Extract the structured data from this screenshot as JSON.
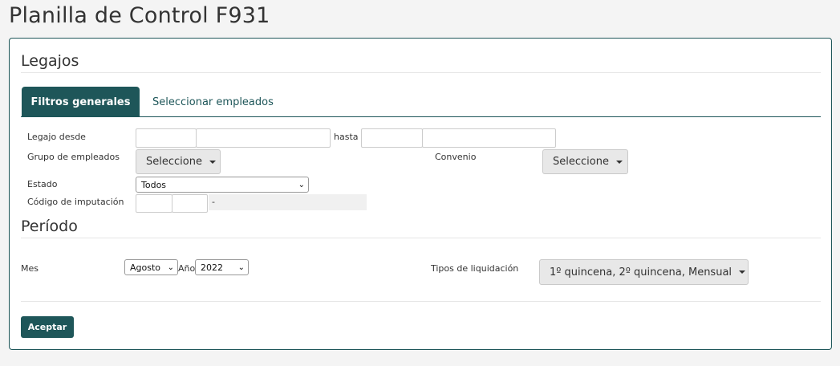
{
  "page": {
    "title": "Planilla de Control F931"
  },
  "legajos": {
    "title": "Legajos",
    "tabs": [
      {
        "label": "Filtros generales",
        "active": true
      },
      {
        "label": "Seleccionar empleados",
        "active": false
      }
    ],
    "fields": {
      "legajo_desde_label": "Legajo desde",
      "hasta_label": "hasta",
      "grupo_label": "Grupo de empleados",
      "grupo_value": "Seleccione",
      "convenio_label": "Convenio",
      "convenio_value": "Seleccione",
      "estado_label": "Estado",
      "estado_value": "Todos",
      "codigo_label": "Código de imputación",
      "codigo_separator": "-"
    }
  },
  "periodo": {
    "title": "Período",
    "mes_label": "Mes",
    "mes_value": "Agosto",
    "anio_label": "Año",
    "anio_value": "2022",
    "tipos_label": "Tipos de liquidación",
    "tipos_value": "1º quincena, 2º quincena, Mensual"
  },
  "actions": {
    "accept_label": "Aceptar"
  },
  "colors": {
    "accent": "#1e5659",
    "background": "#f4f4f4"
  }
}
